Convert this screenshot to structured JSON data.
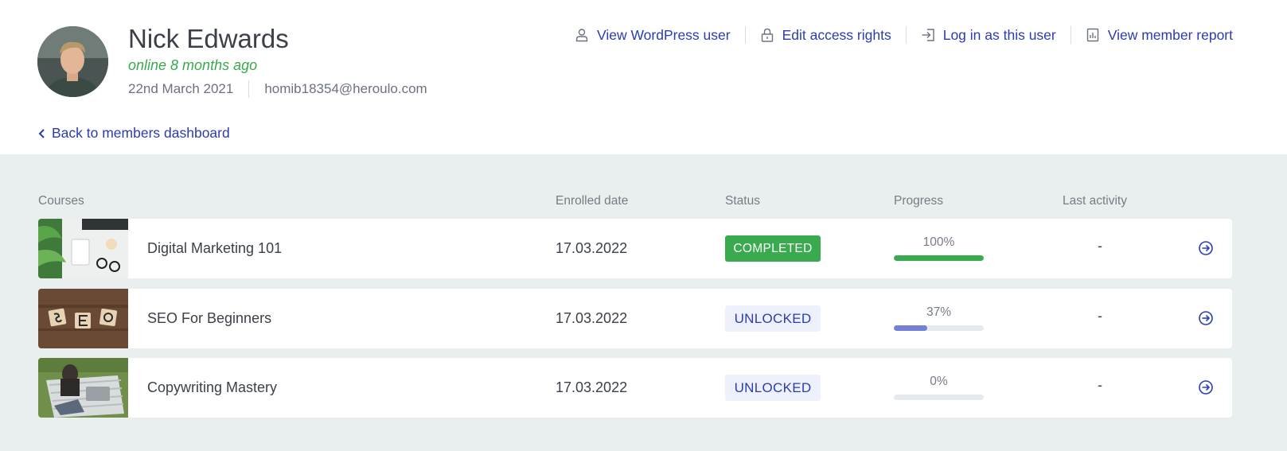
{
  "user": {
    "name": "Nick Edwards",
    "online_status": "online 8 months ago",
    "joined_date": "22nd March 2021",
    "email": "homib18354@heroulo.com"
  },
  "actions": [
    {
      "label": "View WordPress user",
      "icon": "user-icon"
    },
    {
      "label": "Edit access rights",
      "icon": "lock-icon"
    },
    {
      "label": "Log in as this user",
      "icon": "login-icon"
    },
    {
      "label": "View member report",
      "icon": "report-icon"
    }
  ],
  "back_link": "Back to members dashboard",
  "table": {
    "headers": [
      "Courses",
      "Enrolled date",
      "Status",
      "Progress",
      "Last activity"
    ],
    "rows": [
      {
        "course": "Digital Marketing 101",
        "enrolled": "17.03.2022",
        "status": "COMPLETED",
        "progress_label": "100%",
        "progress": 100,
        "last_activity": "-"
      },
      {
        "course": "SEO For Beginners",
        "enrolled": "17.03.2022",
        "status": "UNLOCKED",
        "progress_label": "37%",
        "progress": 37,
        "last_activity": "-"
      },
      {
        "course": "Copywriting Mastery",
        "enrolled": "17.03.2022",
        "status": "UNLOCKED",
        "progress_label": "0%",
        "progress": 0,
        "last_activity": "-"
      }
    ]
  },
  "colors": {
    "link": "#2b3cb3",
    "online": "#3aa84d",
    "completed_badge": "#3aaa4e",
    "progress_complete": "#3aaa4e",
    "progress_partial": "#7280d8",
    "section_bg": "#e9efee"
  }
}
